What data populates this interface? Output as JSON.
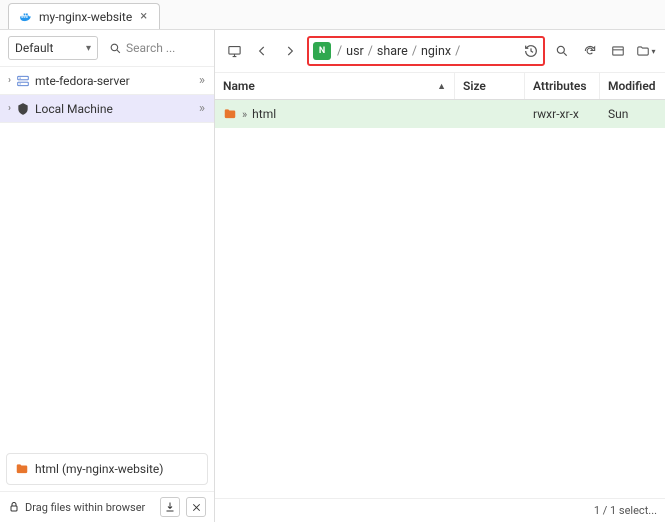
{
  "tab": {
    "title": "my-nginx-website"
  },
  "sidebar": {
    "select_label": "Default",
    "search_placeholder": "Search ...",
    "items": [
      {
        "label": "mte-fedora-server"
      },
      {
        "label": "Local Machine"
      }
    ],
    "card_label": "html (my-nginx-website)",
    "drag_hint": "Drag files within browser"
  },
  "toolbar": {
    "path_segments": [
      "usr",
      "share",
      "nginx"
    ]
  },
  "table": {
    "columns": {
      "name": "Name",
      "size": "Size",
      "attributes": "Attributes",
      "modified": "Modified"
    },
    "rows": [
      {
        "name": "html",
        "size": "",
        "attributes": "rwxr-xr-x",
        "modified": "Sun"
      }
    ]
  },
  "status": {
    "text": "1 / 1 select..."
  }
}
